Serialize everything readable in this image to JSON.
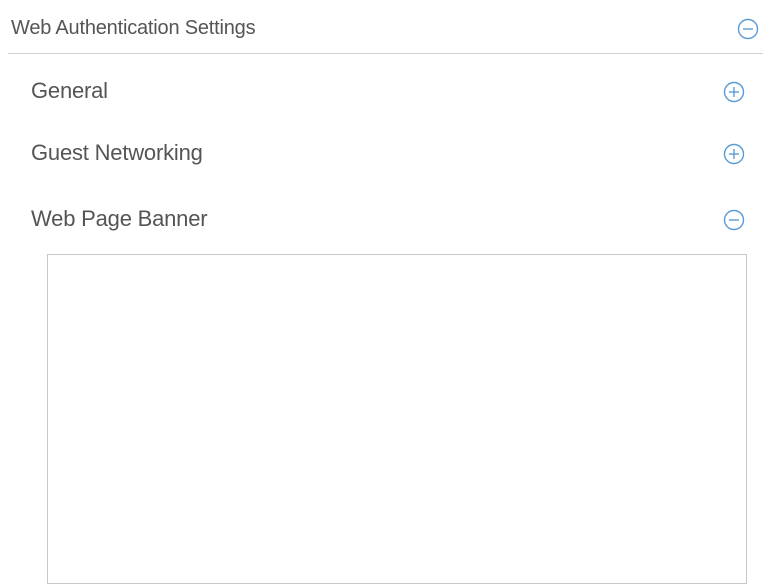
{
  "panel": {
    "title": "Web Authentication Settings",
    "collapse_icon": "minus-circle-icon",
    "sections": [
      {
        "label": "General",
        "state": "collapsed",
        "icon": "plus-circle-icon"
      },
      {
        "label": "Guest Networking",
        "state": "collapsed",
        "icon": "plus-circle-icon"
      },
      {
        "label": "Web Page Banner",
        "state": "expanded",
        "icon": "minus-circle-icon"
      }
    ],
    "banner_text": ""
  },
  "colors": {
    "text": "#555555",
    "icon": "#5b9bd5",
    "divider": "#d0d0d0",
    "textarea_border": "#c8c8c8"
  }
}
